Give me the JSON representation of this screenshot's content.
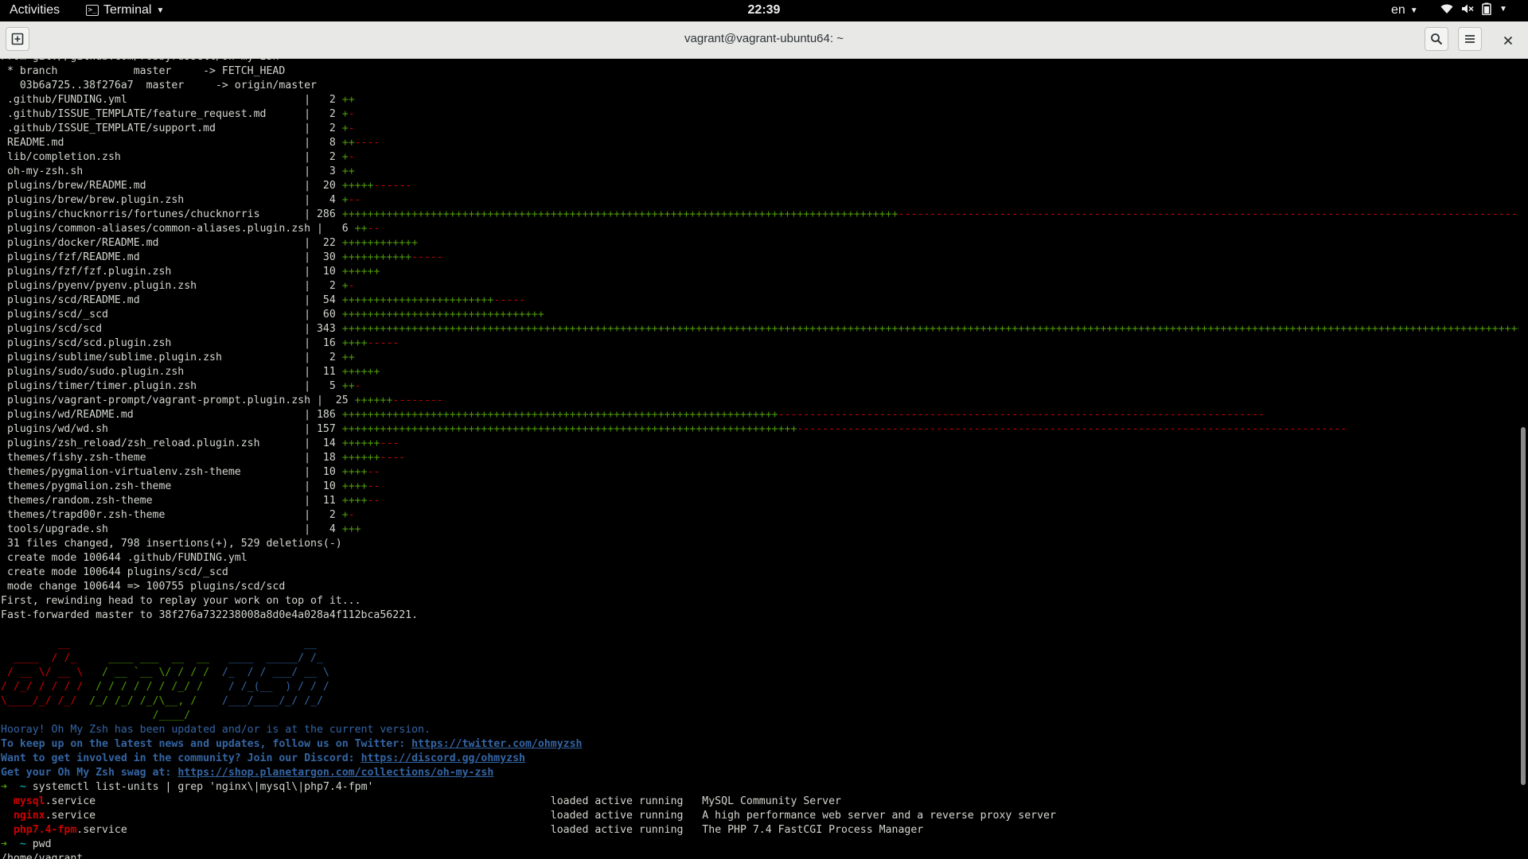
{
  "topbar": {
    "activities": "Activities",
    "app_label": "Terminal",
    "clock": "22:39",
    "lang": "en"
  },
  "window": {
    "title": "vagrant@vagrant-ubuntu64: ~"
  },
  "colors": {
    "green": "#4e9a06",
    "red": "#cc0000",
    "cyan": "#06989a",
    "blue": "#3465a4",
    "text": "#d3d7cf"
  },
  "icons": [
    "new-tab-icon",
    "search-icon",
    "hamburger-menu-icon",
    "close-icon",
    "wifi-icon",
    "speaker-muted-icon",
    "battery-icon",
    "terminal-app-icon"
  ],
  "terminal": {
    "lines": [
      {
        "segs": [
          {
            "t": "From git://github.com/robbyrussell/oh-my-zsh"
          }
        ]
      },
      {
        "segs": [
          {
            "t": " * branch            master     -> FETCH_HEAD"
          }
        ]
      },
      {
        "segs": [
          {
            "t": "   03b6a725..38f276a7  master     -> origin/master"
          }
        ]
      },
      {
        "segs": [
          {
            "t": " .github/FUNDING.yml                            |   2 "
          },
          {
            "t": "++",
            "c": "g"
          }
        ]
      },
      {
        "segs": [
          {
            "t": " .github/ISSUE_TEMPLATE/feature_request.md      |   2 "
          },
          {
            "t": "+",
            "c": "g"
          },
          {
            "t": "-",
            "c": "r"
          }
        ]
      },
      {
        "segs": [
          {
            "t": " .github/ISSUE_TEMPLATE/support.md              |   2 "
          },
          {
            "t": "+",
            "c": "g"
          },
          {
            "t": "-",
            "c": "r"
          }
        ]
      },
      {
        "segs": [
          {
            "t": " README.md                                      |   8 "
          },
          {
            "t": "++",
            "c": "g"
          },
          {
            "t": "----",
            "c": "r"
          }
        ]
      },
      {
        "segs": [
          {
            "t": " lib/completion.zsh                             |   2 "
          },
          {
            "t": "+",
            "c": "g"
          },
          {
            "t": "-",
            "c": "r"
          }
        ]
      },
      {
        "segs": [
          {
            "t": " oh-my-zsh.sh                                   |   3 "
          },
          {
            "t": "++",
            "c": "g"
          }
        ]
      },
      {
        "segs": [
          {
            "t": " plugins/brew/README.md                         |  20 "
          },
          {
            "t": "+++++",
            "c": "g"
          },
          {
            "t": "------",
            "c": "r"
          }
        ]
      },
      {
        "segs": [
          {
            "t": " plugins/brew/brew.plugin.zsh                   |   4 "
          },
          {
            "t": "+",
            "c": "g"
          },
          {
            "t": "--",
            "c": "r"
          }
        ]
      },
      {
        "segs": [
          {
            "t": " plugins/chucknorris/fortunes/chucknorris       | 286 "
          },
          {
            "t": "++++++++++++++++++++++++++++++++++++++++++++++++++++++++++++++++++++++++++++++++++++++++",
            "c": "g"
          },
          {
            "t": "--------------------------------------------------------------------------------------------------------------------------------------------------------------",
            "c": "r"
          }
        ]
      },
      {
        "segs": [
          {
            "t": " plugins/common-aliases/common-aliases.plugin.zsh |   6 "
          },
          {
            "t": "++",
            "c": "g"
          },
          {
            "t": "--",
            "c": "r"
          }
        ]
      },
      {
        "segs": [
          {
            "t": " plugins/docker/README.md                       |  22 "
          },
          {
            "t": "++++++++++++",
            "c": "g"
          }
        ]
      },
      {
        "segs": [
          {
            "t": " plugins/fzf/README.md                          |  30 "
          },
          {
            "t": "+++++++++++",
            "c": "g"
          },
          {
            "t": "-----",
            "c": "r"
          }
        ]
      },
      {
        "segs": [
          {
            "t": " plugins/fzf/fzf.plugin.zsh                     |  10 "
          },
          {
            "t": "++++++",
            "c": "g"
          }
        ]
      },
      {
        "segs": [
          {
            "t": " plugins/pyenv/pyenv.plugin.zsh                 |   2 "
          },
          {
            "t": "+",
            "c": "g"
          },
          {
            "t": "-",
            "c": "r"
          }
        ]
      },
      {
        "segs": [
          {
            "t": " plugins/scd/README.md                          |  54 "
          },
          {
            "t": "++++++++++++++++++++++++",
            "c": "g"
          },
          {
            "t": "-----",
            "c": "r"
          }
        ]
      },
      {
        "segs": [
          {
            "t": " plugins/scd/_scd                               |  60 "
          },
          {
            "t": "++++++++++++++++++++++++++++++++",
            "c": "g"
          }
        ]
      },
      {
        "segs": [
          {
            "t": " plugins/scd/scd                                | 343 "
          },
          {
            "t": "++++++++++++++++++++++++++++++++++++++++++++++++++++++++++++++++++++++++++++++++++++++++++++++++++++++++++++++++++++++++++++++++++++++++++++++++++++++++++++++++++++++++++++++++++++++++++++++++++++++++++++++++++++++",
            "c": "g"
          },
          {
            "t": "-----------------------------------------------------------------------------------------------",
            "c": "r"
          }
        ]
      },
      {
        "segs": [
          {
            "t": " plugins/scd/scd.plugin.zsh                     |  16 "
          },
          {
            "t": "++++",
            "c": "g"
          },
          {
            "t": "-----",
            "c": "r"
          }
        ]
      },
      {
        "segs": [
          {
            "t": " plugins/sublime/sublime.plugin.zsh             |   2 "
          },
          {
            "t": "++",
            "c": "g"
          }
        ]
      },
      {
        "segs": [
          {
            "t": " plugins/sudo/sudo.plugin.zsh                   |  11 "
          },
          {
            "t": "++++++",
            "c": "g"
          }
        ]
      },
      {
        "segs": [
          {
            "t": " plugins/timer/timer.plugin.zsh                 |   5 "
          },
          {
            "t": "++",
            "c": "g"
          },
          {
            "t": "-",
            "c": "r"
          }
        ]
      },
      {
        "segs": [
          {
            "t": " plugins/vagrant-prompt/vagrant-prompt.plugin.zsh |  25 "
          },
          {
            "t": "++++++",
            "c": "g"
          },
          {
            "t": "--------",
            "c": "r"
          }
        ]
      },
      {
        "segs": [
          {
            "t": " plugins/wd/README.md                           | 186 "
          },
          {
            "t": "+++++++++++++++++++++++++++++++++++++++++++++++++++++++++++++++++++++",
            "c": "g"
          },
          {
            "t": "-----------------------------------------------------------------------------",
            "c": "r"
          }
        ]
      },
      {
        "segs": [
          {
            "t": " plugins/wd/wd.sh                               | 157 "
          },
          {
            "t": "++++++++++++++++++++++++++++++++++++++++++++++++++++++++++++++++++++++++",
            "c": "g"
          },
          {
            "t": "---------------------------------------------------------------------------------------",
            "c": "r"
          }
        ]
      },
      {
        "segs": [
          {
            "t": " plugins/zsh_reload/zsh_reload.plugin.zsh       |  14 "
          },
          {
            "t": "++++++",
            "c": "g"
          },
          {
            "t": "---",
            "c": "r"
          }
        ]
      },
      {
        "segs": [
          {
            "t": " themes/fishy.zsh-theme                         |  18 "
          },
          {
            "t": "++++++",
            "c": "g"
          },
          {
            "t": "----",
            "c": "r"
          }
        ]
      },
      {
        "segs": [
          {
            "t": " themes/pygmalion-virtualenv.zsh-theme          |  10 "
          },
          {
            "t": "++++",
            "c": "g"
          },
          {
            "t": "--",
            "c": "r"
          }
        ]
      },
      {
        "segs": [
          {
            "t": " themes/pygmalion.zsh-theme                     |  10 "
          },
          {
            "t": "++++",
            "c": "g"
          },
          {
            "t": "--",
            "c": "r"
          }
        ]
      },
      {
        "segs": [
          {
            "t": " themes/random.zsh-theme                        |  11 "
          },
          {
            "t": "++++",
            "c": "g"
          },
          {
            "t": "--",
            "c": "r"
          }
        ]
      },
      {
        "segs": [
          {
            "t": " themes/trapd00r.zsh-theme                      |   2 "
          },
          {
            "t": "+",
            "c": "g"
          },
          {
            "t": "-",
            "c": "r"
          }
        ]
      },
      {
        "segs": [
          {
            "t": " tools/upgrade.sh                               |   4 "
          },
          {
            "t": "+++",
            "c": "g"
          }
        ]
      },
      {
        "segs": [
          {
            "t": " 31 files changed, 798 insertions(+), 529 deletions(-)"
          }
        ]
      },
      {
        "segs": [
          {
            "t": " create mode 100644 .github/FUNDING.yml"
          }
        ]
      },
      {
        "segs": [
          {
            "t": " create mode 100644 plugins/scd/_scd"
          }
        ]
      },
      {
        "segs": [
          {
            "t": " mode change 100644 => 100755 plugins/scd/scd"
          }
        ]
      },
      {
        "segs": [
          {
            "t": "First, rewinding head to replay your work on top of it..."
          }
        ]
      },
      {
        "segs": [
          {
            "t": "Fast-forwarded master to 38f276a732238008a8d0e4a028a4f112bca56221."
          }
        ]
      },
      {
        "segs": [
          {
            "t": ""
          }
        ]
      },
      {
        "segs": [
          {
            "t": "         __",
            "c": "r"
          },
          {
            "t": "                                     "
          },
          {
            "t": "__",
            "c": "bl"
          }
        ]
      },
      {
        "segs": [
          {
            "t": "  ____  / /_",
            "c": "r"
          },
          {
            "t": "     ____ ___  __  __",
            "c": "g"
          },
          {
            "t": "   ____  _____/ /_",
            "c": "bl"
          }
        ]
      },
      {
        "segs": [
          {
            "t": " / __ \\/ __ \\",
            "c": "r"
          },
          {
            "t": "   / __ `__ \\/ / / /",
            "c": "g"
          },
          {
            "t": "  /_  / / ___/ __ \\",
            "c": "bl"
          }
        ]
      },
      {
        "segs": [
          {
            "t": "/ /_/ / / / /",
            "c": "r"
          },
          {
            "t": "  / / / / / / /_/ /",
            "c": "g"
          },
          {
            "t": "    / /_(__  ) / / /",
            "c": "bl"
          }
        ]
      },
      {
        "segs": [
          {
            "t": "\\____/_/ /_/",
            "c": "r"
          },
          {
            "t": "  /_/ /_/ /_/\\__, /",
            "c": "g"
          },
          {
            "t": "    /___/____/_/ /_/",
            "c": "bl"
          }
        ]
      },
      {
        "segs": [
          {
            "t": "                        "
          },
          {
            "t": "/____/",
            "c": "g"
          }
        ]
      },
      {
        "segs": [
          {
            "t": "Hooray! Oh My Zsh has been updated and/or is at the current version.",
            "c": "bl"
          }
        ]
      },
      {
        "segs": [
          {
            "t": "To keep up on the latest news and updates, follow us on Twitter: ",
            "c": "bl b"
          },
          {
            "t": "https://twitter.com/ohmyzsh",
            "c": "bl b u"
          }
        ]
      },
      {
        "segs": [
          {
            "t": "Want to get involved in the community? Join our Discord: ",
            "c": "bl b"
          },
          {
            "t": "https://discord.gg/ohmyzsh",
            "c": "bl b u"
          }
        ]
      },
      {
        "segs": [
          {
            "t": "Get your Oh My Zsh swag at: ",
            "c": "bl b"
          },
          {
            "t": "https://shop.planetargon.com/collections/oh-my-zsh",
            "c": "bl b u"
          }
        ]
      },
      {
        "segs": [
          {
            "t": "➜",
            "c": "g b"
          },
          {
            "t": "  ",
            "c": ""
          },
          {
            "t": "~",
            "c": "cy b"
          },
          {
            "t": " systemctl list-units | grep 'nginx\\|mysql\\|php7.4-fpm'"
          }
        ]
      },
      {
        "segs": [
          {
            "t": "  "
          },
          {
            "t": "mysql",
            "c": "r b"
          },
          {
            "t": ".service                                                                        loaded active running   MySQL Community Server"
          }
        ]
      },
      {
        "segs": [
          {
            "t": "  "
          },
          {
            "t": "nginx",
            "c": "r b"
          },
          {
            "t": ".service                                                                        loaded active running   A high performance web server and a reverse proxy server"
          }
        ]
      },
      {
        "segs": [
          {
            "t": "  "
          },
          {
            "t": "php7.4-fpm",
            "c": "r b"
          },
          {
            "t": ".service                                                                   loaded active running   The PHP 7.4 FastCGI Process Manager"
          }
        ]
      },
      {
        "segs": [
          {
            "t": "➜",
            "c": "g b"
          },
          {
            "t": "  "
          },
          {
            "t": "~",
            "c": "cy b"
          },
          {
            "t": " pwd"
          }
        ]
      },
      {
        "segs": [
          {
            "t": "/home/vagrant"
          }
        ]
      }
    ]
  }
}
